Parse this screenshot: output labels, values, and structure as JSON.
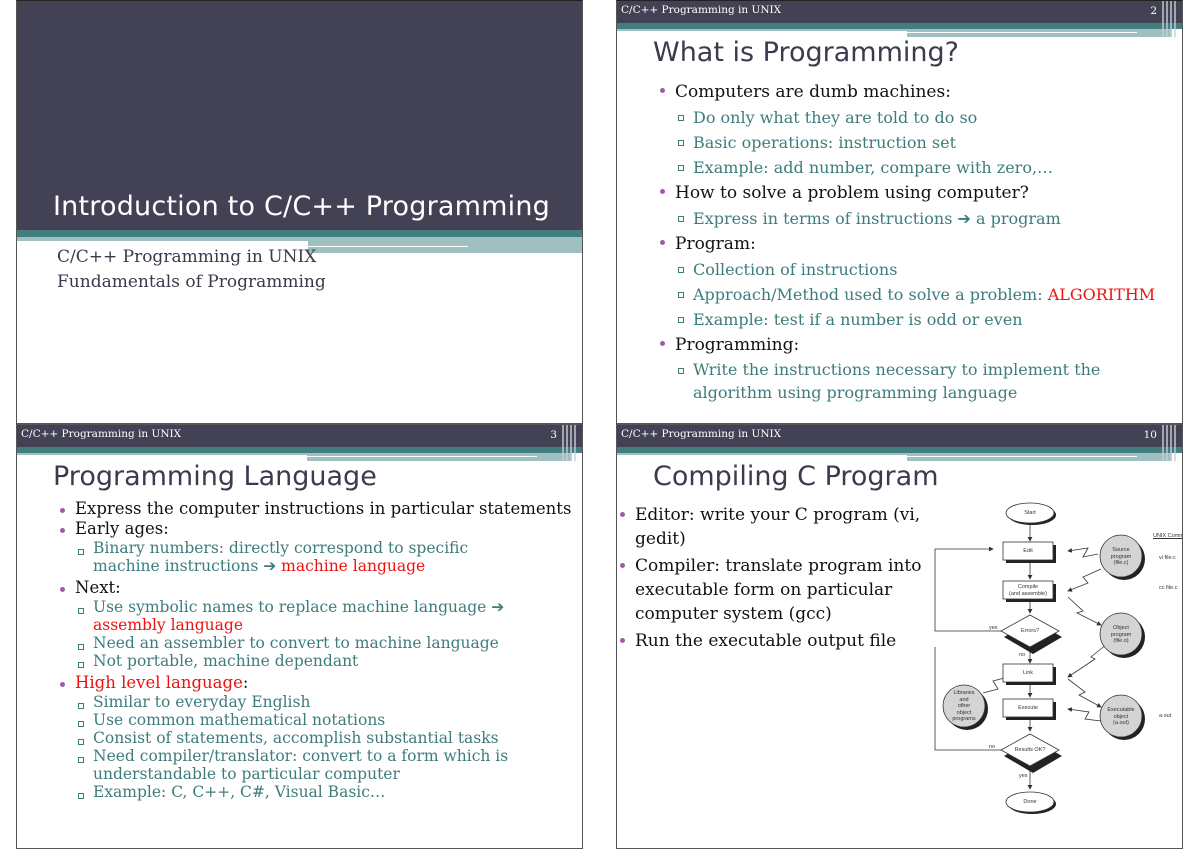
{
  "slides": {
    "slide1": {
      "title": "Introduction to C/C++ Programming",
      "subtitle_lines": [
        "C/C++ Programming in UNIX",
        "Fundamentals of Programming"
      ]
    },
    "slide2": {
      "header_label": "C/C++ Programming in UNIX",
      "page_number": "2",
      "heading": "What is Programming?",
      "bullets": [
        {
          "text": "Computers are dumb machines:"
        },
        {
          "text": "Do only what they are told to do so"
        },
        {
          "text": "Basic operations: instruction set"
        },
        {
          "text": "Example: add number, compare with zero,…"
        },
        {
          "text": "How to solve a problem using computer?"
        },
        {
          "text": "Express in terms of instructions ➔ a program"
        },
        {
          "text": "Program:"
        },
        {
          "text": "Collection of instructions"
        },
        {
          "text": "Approach/Method used to solve a problem: ",
          "highlight": "ALGORITHM"
        },
        {
          "text": "Example: test if a number is odd or even"
        },
        {
          "text": "Programming:"
        },
        {
          "text": "Write the instructions necessary to implement the algorithm using programming language"
        }
      ]
    },
    "slide3": {
      "header_label": "C/C++ Programming in UNIX",
      "page_number": "3",
      "heading": "Programming Language",
      "bullets": [
        {
          "text": "Express the computer instructions in particular statements"
        },
        {
          "text": "Early ages:"
        },
        {
          "text": "Binary numbers: directly correspond to specific machine instructions ➔ ",
          "highlight": "machine language"
        },
        {
          "text": "Next:"
        },
        {
          "text": "Use symbolic names to replace machine language ➔ ",
          "highlight": "assembly language"
        },
        {
          "text": "Need an assembler to convert to machine language"
        },
        {
          "text": "Not portable, machine dependant"
        },
        {
          "highlight": "High level language",
          "text": ":"
        },
        {
          "text": "Similar to everyday English"
        },
        {
          "text": "Use common mathematical notations"
        },
        {
          "text": "Consist of statements, accomplish substantial tasks"
        },
        {
          "text": "Need compiler/translator: convert to a form which is understandable to particular computer"
        },
        {
          "text": "Example: C, C++, C#, Visual Basic…"
        }
      ]
    },
    "slide4": {
      "header_label": "C/C++ Programming in UNIX",
      "page_number": "10",
      "heading": "Compiling C Program",
      "bullets": [
        {
          "text": "Editor: write your C program (vi, gedit)"
        },
        {
          "text": "Compiler: translate program into executable form on particular computer system (gcc)"
        },
        {
          "text": "Run the executable output file"
        }
      ],
      "flowchart": {
        "nodes": {
          "start": "Start",
          "edit": "Edit",
          "compile": [
            "Compile",
            "(and assemble)"
          ],
          "errors": "Errors?",
          "link": "Link",
          "execute": "Execute",
          "results": "Results OK?",
          "done": "Done",
          "source": [
            "Source",
            "program",
            "(file.c)"
          ],
          "object": [
            "Object",
            "program",
            "(file.o)"
          ],
          "libraries": [
            "Libraries",
            "and",
            "other",
            "object",
            "programs"
          ],
          "executable": [
            "Executable",
            "object",
            "(a.out)"
          ]
        },
        "edge_labels": {
          "errors_yes": "yes",
          "errors_no": "no",
          "results_no": "no",
          "results_yes": "yes"
        },
        "unix_header": "UNIX Command",
        "unix_commands": {
          "edit": "vi file.c",
          "compile": "cc file.c",
          "execute": "a.out"
        }
      }
    }
  },
  "colors": {
    "header_bg": "#424254",
    "teal": "#437d80",
    "light_teal": "#9fc0c1",
    "sub_text": "#3e7c7c",
    "highlight": "#ee1111",
    "bullet": "#a05aa8"
  }
}
